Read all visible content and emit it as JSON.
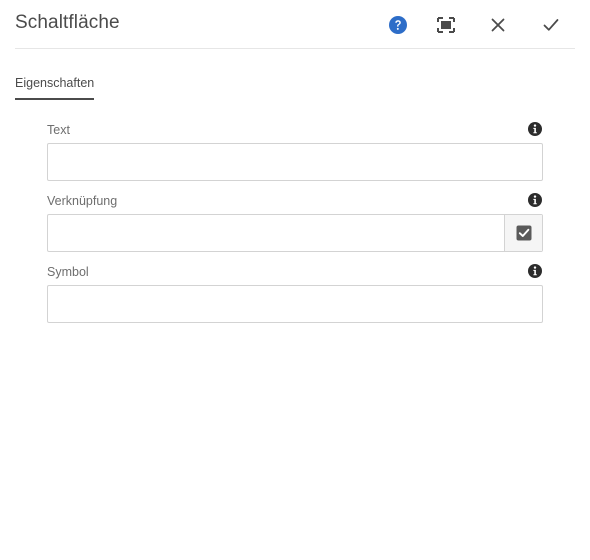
{
  "dialog": {
    "title": "Schaltfläche",
    "actions": {
      "help_icon": "help-icon",
      "fullscreen_icon": "fullscreen-icon",
      "close_icon": "close-icon",
      "done_icon": "checkmark-icon"
    }
  },
  "tabs": [
    {
      "label": "Eigenschaften",
      "active": true
    }
  ],
  "fields": [
    {
      "label": "Text",
      "value": "",
      "info_icon": "info-icon"
    },
    {
      "label": "Verknüpfung",
      "value": "",
      "info_icon": "info-icon",
      "picker_icon": "checkbox-checked-icon"
    },
    {
      "label": "Symbol",
      "value": "",
      "info_icon": "info-icon"
    }
  ],
  "colors": {
    "accent": "#2d6dc8",
    "text": "#4b4b4b",
    "label": "#6e6e6e",
    "border": "#d3d3d3"
  }
}
